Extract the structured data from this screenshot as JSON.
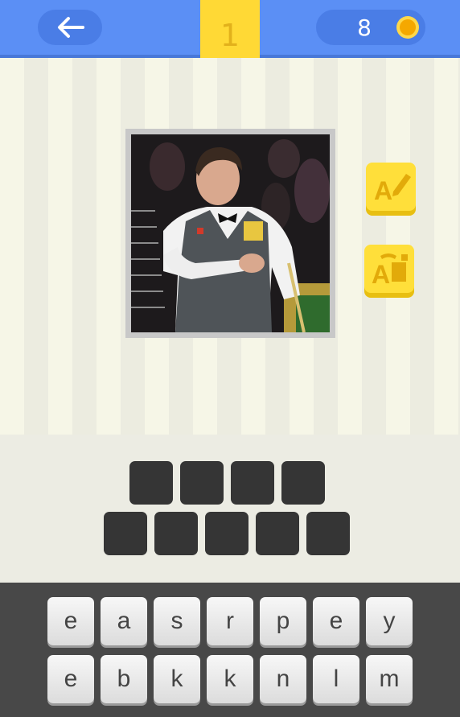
{
  "header": {
    "level": "1",
    "coins": "8",
    "back_icon": "arrow-left-icon",
    "coin_icon": "coin-icon"
  },
  "puzzle": {
    "image_icon": "snooker-player-photo",
    "hints": [
      {
        "icon": "reveal-letter-icon"
      },
      {
        "icon": "remove-letters-icon"
      }
    ],
    "answer_rows": [
      4,
      5
    ]
  },
  "keyboard": {
    "row1": [
      "e",
      "a",
      "s",
      "r",
      "p",
      "e",
      "y"
    ],
    "row2": [
      "e",
      "b",
      "k",
      "k",
      "n",
      "l",
      "m"
    ]
  },
  "colors": {
    "header": "#5b8ff5",
    "accent_yellow": "#ffd935",
    "slot": "#353535"
  }
}
